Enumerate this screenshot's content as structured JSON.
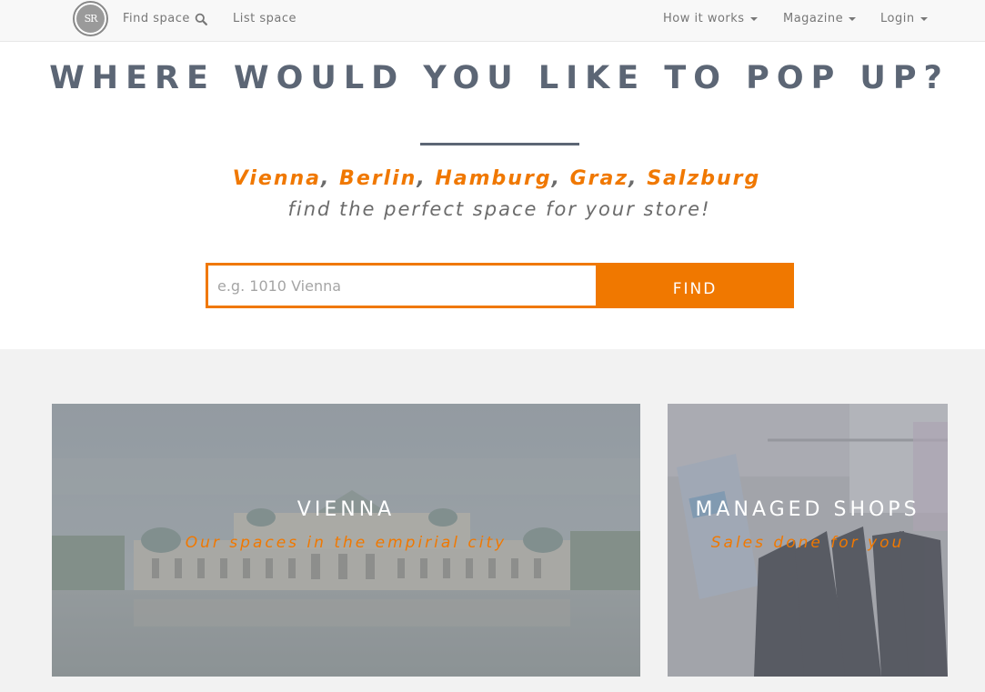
{
  "nav": {
    "logo_text": "SR",
    "find_space": "Find space",
    "list_space": "List space",
    "how_it_works": "How it works",
    "magazine": "Magazine",
    "login": "Login"
  },
  "hero": {
    "headline": "WHERE WOULD YOU LIKE TO POP UP?",
    "cities": [
      "Vienna",
      "Berlin",
      "Hamburg",
      "Graz",
      "Salzburg"
    ],
    "separator": ", ",
    "tagline": "find the perfect space for your store!"
  },
  "search": {
    "placeholder": "e.g. 1010 Vienna",
    "value": "",
    "button_label": "FIND"
  },
  "cards": [
    {
      "title": "VIENNA",
      "subtitle": "Our spaces in the empirial city"
    },
    {
      "title": "MANAGED SHOPS",
      "subtitle": "Sales done for you"
    }
  ],
  "colors": {
    "accent": "#f07800",
    "heading": "#5c6675",
    "text": "#6b6b6b",
    "navbar_bg": "#f8f8f8",
    "section_bg": "#f2f2f2"
  },
  "icons": [
    "search-icon",
    "caret-down-icon"
  ]
}
